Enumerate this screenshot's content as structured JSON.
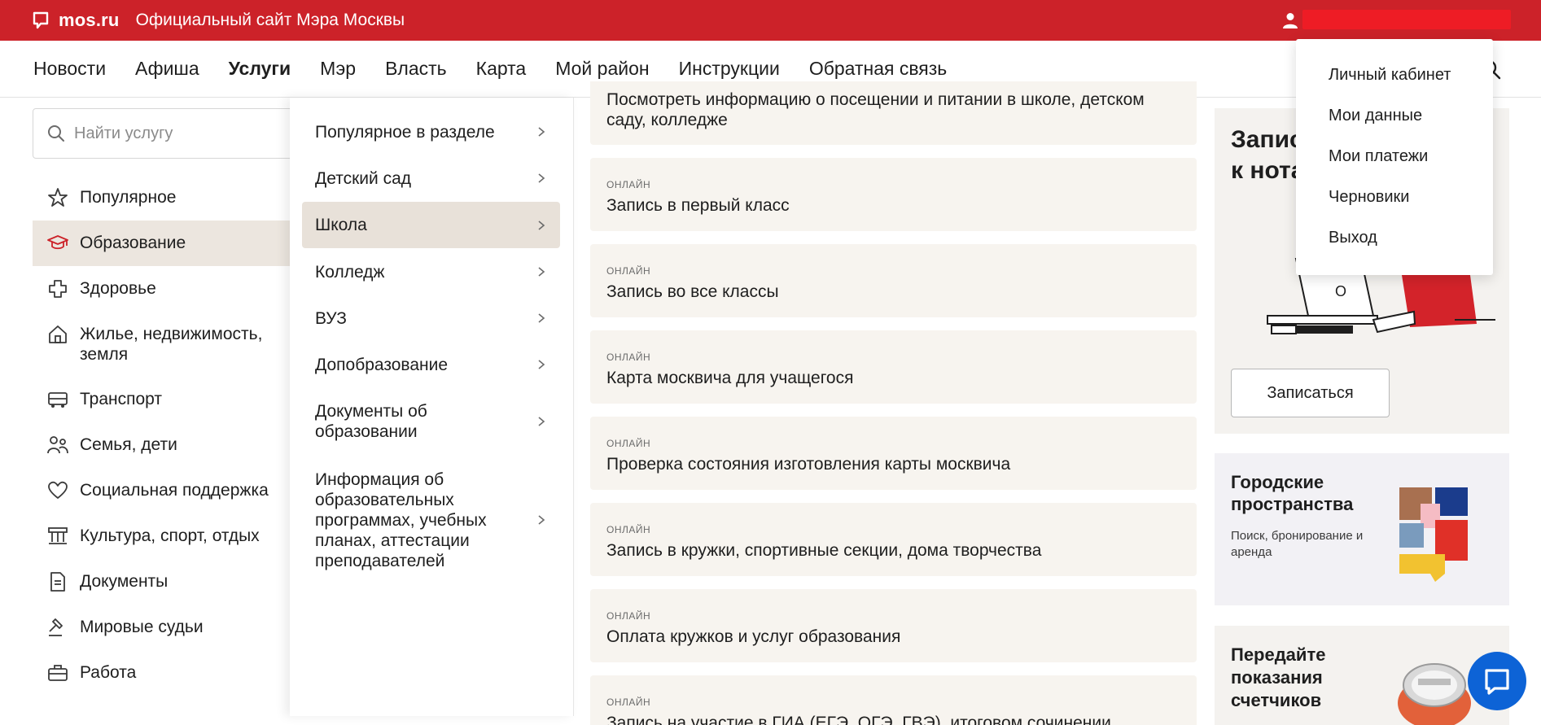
{
  "topbar": {
    "logo": "mos.ru",
    "subtitle": "Официальный сайт Мэра Москвы"
  },
  "nav": {
    "items": [
      "Новости",
      "Афиша",
      "Услуги",
      "Мэр",
      "Власть",
      "Карта",
      "Мой район",
      "Инструкции",
      "Обратная связь"
    ],
    "active": "Услуги"
  },
  "search": {
    "placeholder": "Найти услугу"
  },
  "categories": [
    {
      "label": "Популярное",
      "icon": "star-icon"
    },
    {
      "label": "Образование",
      "icon": "graduation-cap-icon",
      "active": true
    },
    {
      "label": "Здоровье",
      "icon": "medical-cross-icon"
    },
    {
      "label": "Жилье, недвижимость, земля",
      "icon": "house-icon"
    },
    {
      "label": "Транспорт",
      "icon": "bus-icon"
    },
    {
      "label": "Семья, дети",
      "icon": "family-icon"
    },
    {
      "label": "Социальная поддержка",
      "icon": "heart-icon"
    },
    {
      "label": "Культура, спорт, отдых",
      "icon": "museum-icon"
    },
    {
      "label": "Документы",
      "icon": "document-icon"
    },
    {
      "label": "Мировые судьи",
      "icon": "gavel-icon"
    },
    {
      "label": "Работа",
      "icon": "briefcase-icon"
    }
  ],
  "subcategories": [
    {
      "label": "Популярное в разделе"
    },
    {
      "label": "Детский сад"
    },
    {
      "label": "Школа",
      "active": true
    },
    {
      "label": "Колледж"
    },
    {
      "label": "ВУЗ"
    },
    {
      "label": "Допобразование"
    },
    {
      "label": "Документы об образовании"
    },
    {
      "label": "Информация об образовательных программах, учебных планах, аттестации преподавателей"
    }
  ],
  "services": [
    {
      "badge": "",
      "title": "Посмотреть информацию о посещении и питании в школе, детском саду, колледже"
    },
    {
      "badge": "ОНЛАЙН",
      "title": "Запись в первый класс"
    },
    {
      "badge": "ОНЛАЙН",
      "title": "Запись во все классы"
    },
    {
      "badge": "ОНЛАЙН",
      "title": "Карта москвича для учащегося"
    },
    {
      "badge": "ОНЛАЙН",
      "title": "Проверка состояния изготовления карты москвича"
    },
    {
      "badge": "ОНЛАЙН",
      "title": "Запись в кружки, спортивные секции, дома творчества"
    },
    {
      "badge": "ОНЛАЙН",
      "title": "Оплата кружков и услуг образования"
    },
    {
      "badge": "ОНЛАЙН",
      "title": "Запись на участие в ГИА (ЕГЭ, ОГЭ, ГВЭ), итоговом сочинении"
    }
  ],
  "promos": {
    "notary": {
      "title": "Запис\nк нота",
      "button": "Записаться"
    },
    "spaces": {
      "title": "Городские пространства",
      "text": "Поиск, бронирование и аренда"
    },
    "meters": {
      "title": "Передайте показания счетчиков"
    }
  },
  "user_menu": [
    "Личный кабинет",
    "Мои данные",
    "Мои платежи",
    "Черновики",
    "Выход"
  ],
  "colors": {
    "brand_red": "#cc2229",
    "active_bg": "#e8e1d9",
    "card_bg": "#f7f4ef",
    "chat_blue": "#0d63d6"
  }
}
